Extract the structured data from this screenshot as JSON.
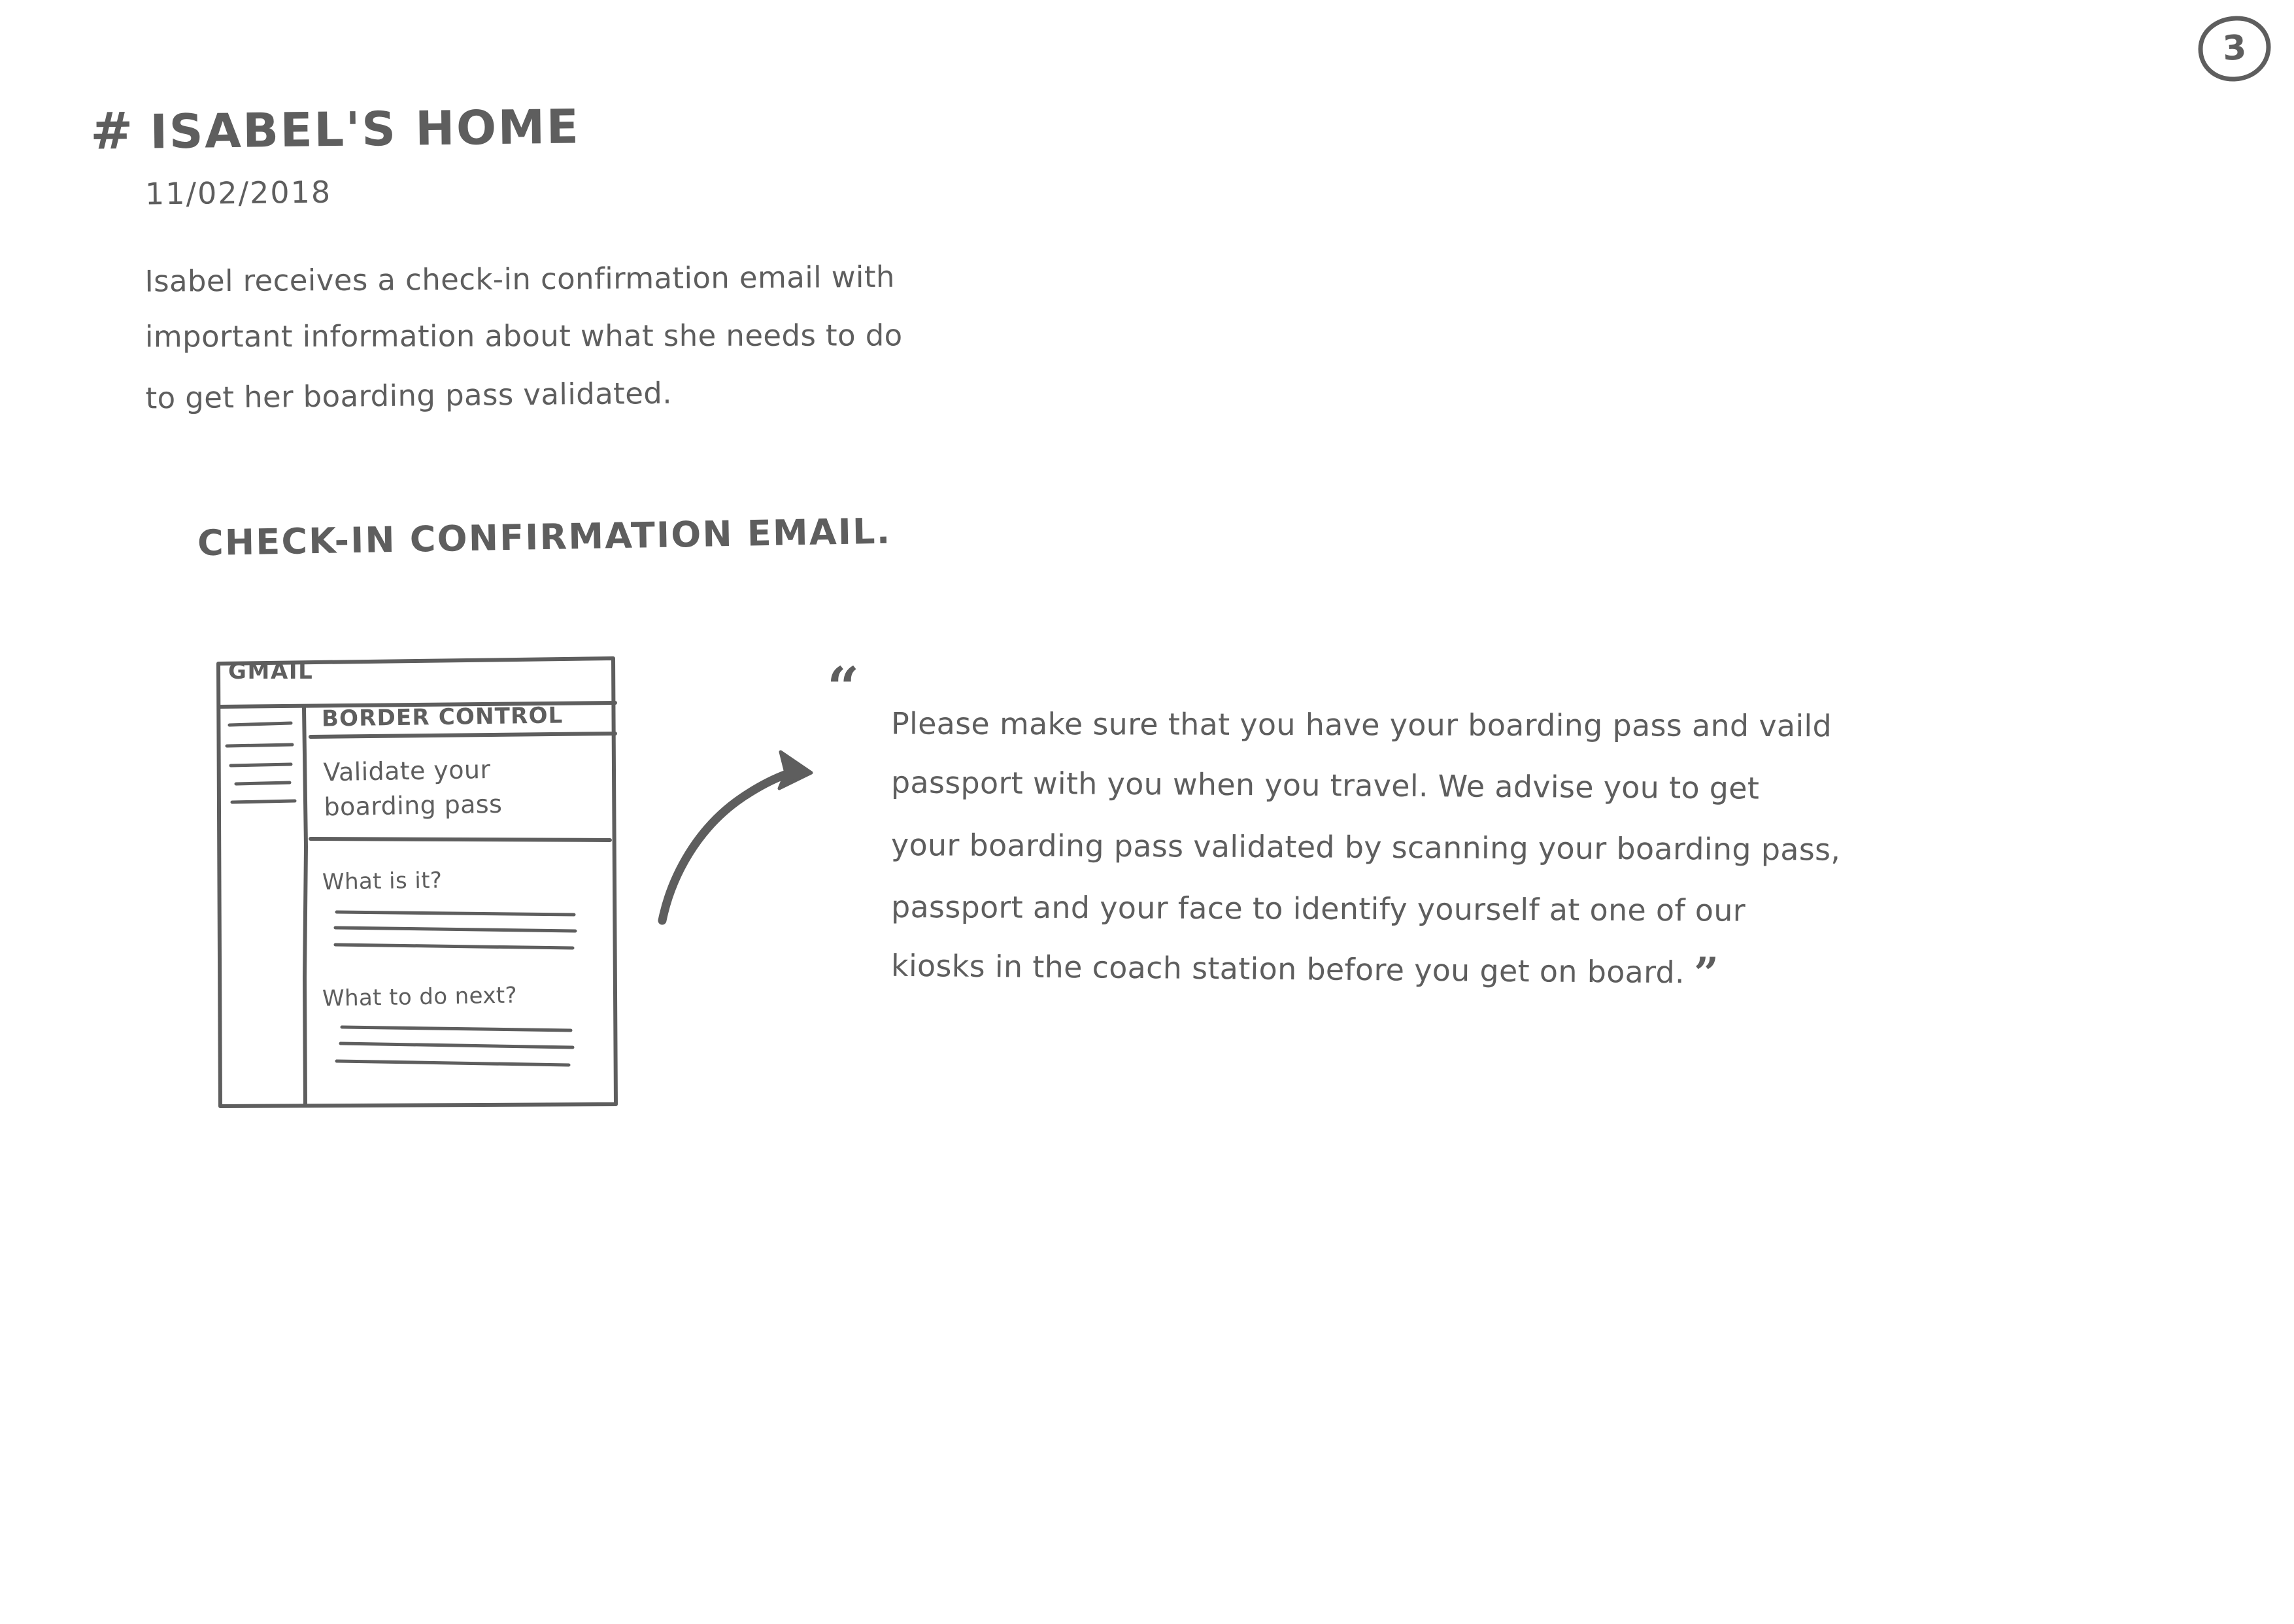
{
  "page": {
    "number": "3",
    "number_icon": "circled-number",
    "ink_color": "#5e5e5e",
    "background_color": "#ffffff"
  },
  "header": {
    "hash_icon": "#",
    "title": "ISABEL'S HOME",
    "date": "11/02/2018"
  },
  "intro": {
    "line1": "Isabel receives a check-in confirmation email with",
    "line2": "important information about what she needs to do",
    "line3": "to get her boarding pass validated."
  },
  "section": {
    "heading": "CHECK-IN CONFIRMATION EMAIL."
  },
  "wireframe": {
    "app_name": "GMAIL",
    "sender": "BORDER CONTROL",
    "subject_line1": "Validate your",
    "subject_line2": "boarding pass",
    "section_1_heading": "What is it?",
    "section_2_heading": "What to do next?",
    "sidebar_item_count": 5,
    "body_placeholder_lines_per_section": 3
  },
  "connector": {
    "icon": "curved-arrow-icon",
    "direction": "from-wireframe-to-quote"
  },
  "quote": {
    "open_mark": "“",
    "close_mark": "”",
    "line1": "Please make sure that you have your boarding pass and vaild",
    "line2": "passport with you when you travel. We advise you to get",
    "line3": "your boarding pass validated by scanning your boarding pass,",
    "line4": "passport and your face to identify yourself at one of our",
    "line5": "kiosks in the coach station before you get on board."
  }
}
